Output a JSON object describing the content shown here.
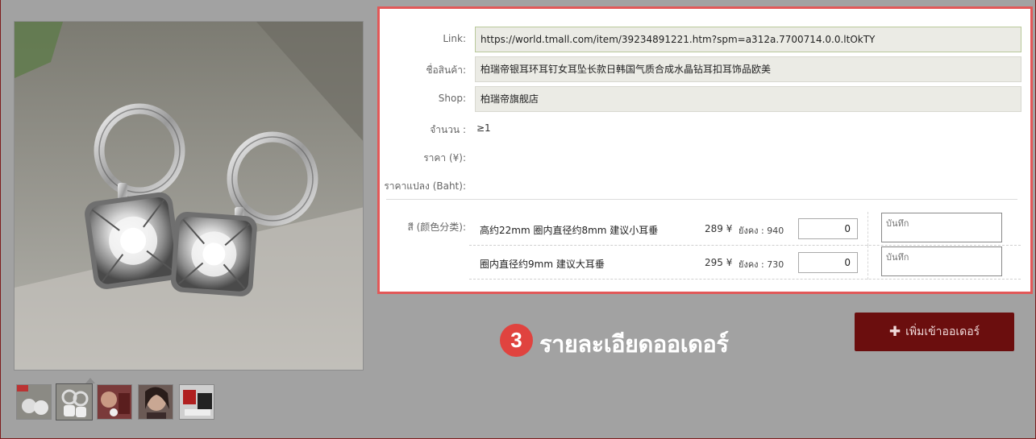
{
  "product": {
    "link_label": "Link:",
    "link_value": "https://world.tmall.com/item/39234891221.htm?spm=a312a.7700714.0.0.ltOkTY",
    "name_label": "ชื่อสินค้า:",
    "name_value": "柏瑞帝银耳环耳钉女耳坠长款日韩国气质合成水晶钻耳扣耳饰品欧美",
    "shop_label": "Shop:",
    "shop_value": "柏瑞帝旗舰店",
    "qty_label": "จำนวน :",
    "qty_value": "≥1",
    "price_label": "ราคา (¥):",
    "price_value": "",
    "baht_label": "ราคาแปลง (Baht):",
    "baht_value": "",
    "color_label": "สี (颜色分类):"
  },
  "variants": [
    {
      "name": "高约22mm 圈内直径约8mm 建议小耳垂",
      "price": "289 ¥",
      "stock": "ยังคง : 940",
      "qty": "0",
      "note_placeholder": "บันทึก"
    },
    {
      "name": "圈内直径约9mm 建议大耳垂",
      "price": "295 ¥",
      "stock": "ยังคง : 730",
      "qty": "0",
      "note_placeholder": "บันทึก"
    }
  ],
  "annotation": {
    "step_number": "3",
    "step_text": "รายละเอียดออเดอร์"
  },
  "actions": {
    "add_icon": "plus-icon",
    "add_label": "เพิ่มเข้าออเดอร์"
  },
  "gallery": {
    "selected_index": 1,
    "thumb_count": 5
  },
  "colors": {
    "highlight_border": "#e25858",
    "button_bg": "#6b0e0e",
    "step_circle": "#e0433f",
    "overlay": "#a2a2a2"
  }
}
